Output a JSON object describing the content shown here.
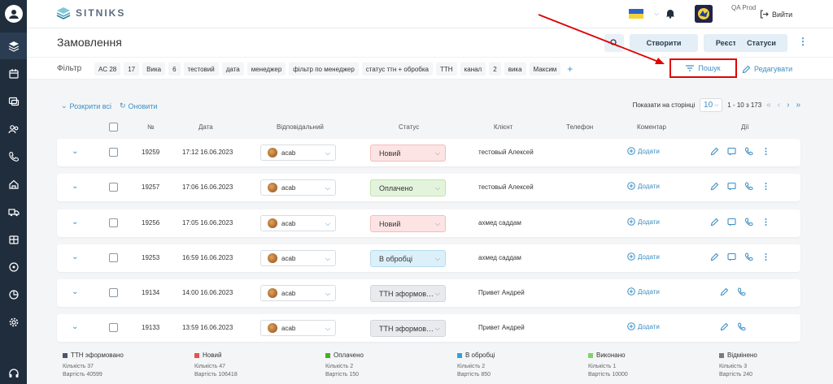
{
  "app": {
    "logo_text": "SITNIKS",
    "account_label": "QA Prod",
    "logout_label": "Вийти"
  },
  "colors": {
    "accent": "#3e8fc4",
    "sidebar": "#1f2d3d",
    "highlight": "#e00000"
  },
  "sidebar": {
    "icons": [
      "user-avatar-icon",
      "layers-icon",
      "calendar-icon",
      "chat-icon",
      "users-icon",
      "phone-icon",
      "home-icon",
      "truck-icon",
      "box-icon",
      "chart-icon",
      "pie-icon",
      "gear-icon",
      "headset-icon"
    ]
  },
  "header": {
    "title": "Замовлення",
    "buttons": {
      "create": "Створити",
      "registers": "Реєстри",
      "statuses": "Статуси"
    }
  },
  "filter": {
    "label": "Фільтр",
    "chips": [
      "AC 28",
      "17",
      "Вика",
      "6",
      "тестовий",
      "дата",
      "менеджер",
      "фільтр по менеджер",
      "статус ттн + обробка",
      "ТТН",
      "канал",
      "2",
      "вика",
      "Максим"
    ],
    "search_label": "Пошук",
    "edit_label": "Редагувати"
  },
  "toolbar": {
    "expand_all": "Розкрити всі",
    "refresh": "Оновити",
    "per_page_label": "Показати на сторінці",
    "per_page_value": "10",
    "range": "1 - 10 з 173"
  },
  "columns": {
    "num": "№",
    "date": "Дата",
    "responsible": "Відповідальний",
    "status": "Статус",
    "client": "Клієнт",
    "phone": "Телефон",
    "comment": "Коментар",
    "actions": "Дії"
  },
  "comment_add": "Додати",
  "rows": [
    {
      "num": "19259",
      "date": "17:12 16.06.2023",
      "responsible": "acab",
      "status": "Новий",
      "status_type": "new",
      "client": "тестовый Алексей",
      "actions": 4
    },
    {
      "num": "19257",
      "date": "17:06 16.06.2023",
      "responsible": "acab",
      "status": "Оплачено",
      "status_type": "paid",
      "client": "тестовый Алексей",
      "actions": 4
    },
    {
      "num": "19256",
      "date": "17:05 16.06.2023",
      "responsible": "acab",
      "status": "Новий",
      "status_type": "new",
      "client": "ахмед саддам",
      "actions": 4
    },
    {
      "num": "19253",
      "date": "16:59 16.06.2023",
      "responsible": "acab",
      "status": "В обробці",
      "status_type": "processing",
      "client": "ахмед саддам",
      "actions": 4
    },
    {
      "num": "19134",
      "date": "14:00 16.06.2023",
      "responsible": "acab",
      "status": "ТТН эформов…",
      "status_type": "ttn",
      "client": "Привет Андрей",
      "actions": 2
    },
    {
      "num": "19133",
      "date": "13:59 16.06.2023",
      "responsible": "acab",
      "status": "ТТН эформов…",
      "status_type": "ttn",
      "client": "Привет Андрей",
      "actions": 2
    }
  ],
  "legend": [
    {
      "name": "ТТН эформовано",
      "color": "#4e5566",
      "count": "Кількість 37",
      "cost": "Вартість 40599"
    },
    {
      "name": "Новий",
      "color": "#e8504f",
      "count": "Кількість 47",
      "cost": "Вартість 106418"
    },
    {
      "name": "Оплачено",
      "color": "#3fb31f",
      "count": "Кількість 2",
      "cost": "Вартість 150"
    },
    {
      "name": "В обробці",
      "color": "#2fa3d8",
      "count": "Кількість 2",
      "cost": "Вартість 850"
    },
    {
      "name": "Виконано",
      "color": "#7ed36b",
      "count": "Кількість 1",
      "cost": "Вартість 10000"
    },
    {
      "name": "Відмінено",
      "color": "#7a7a7a",
      "count": "Кількість 3",
      "cost": "Вартість 240"
    }
  ]
}
